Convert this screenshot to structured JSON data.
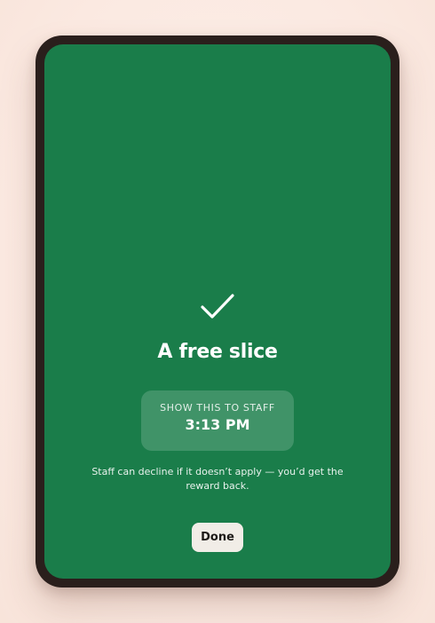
{
  "confirmation": {
    "icon": "checkmark-icon",
    "title": "A free slice",
    "staff_label": "SHOW THIS TO STAFF",
    "time": "3:13 PM",
    "note": "Staff can decline if it doesn’t apply — you’d get the reward back.",
    "done_label": "Done"
  },
  "colors": {
    "screen_background": "#1a7d4a",
    "device_frame": "#2a1f1c",
    "page_background": "#fbede6",
    "done_button": "#f1ede7"
  }
}
